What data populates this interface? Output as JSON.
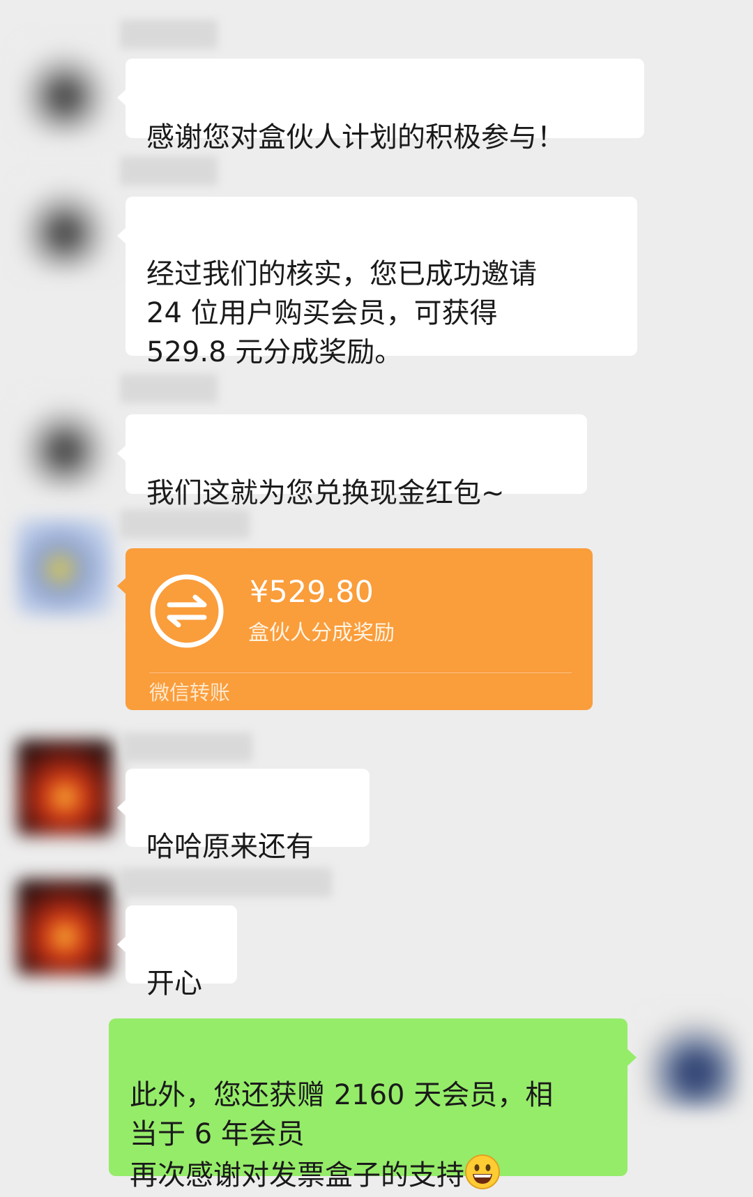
{
  "messages": [
    {
      "text": "感谢您对盒伙人计划的积极参与！"
    },
    {
      "text": "经过我们的核实，您已成功邀请\n24 位用户购买会员，可获得\n529.8 元分成奖励。"
    },
    {
      "text": "我们这就为您兑换现金红包~"
    },
    {
      "transfer": {
        "amount": "¥529.80",
        "description": "盒伙人分成奖励",
        "footer": "微信转账",
        "icon": "transfer-arrows-icon",
        "color": "#fa9d3b"
      }
    },
    {
      "text": "哈哈原来还有"
    },
    {
      "text": "开心"
    },
    {
      "text": "此外，您还获赠 2160 天会员，相\n当于 6 年会员\n再次感谢对发票盒子的支持",
      "emoji": "grinning-face-icon"
    }
  ],
  "colors": {
    "background": "#ededed",
    "incoming_bubble": "#ffffff",
    "outgoing_bubble": "#95ec69",
    "transfer_card": "#fa9d3b"
  }
}
